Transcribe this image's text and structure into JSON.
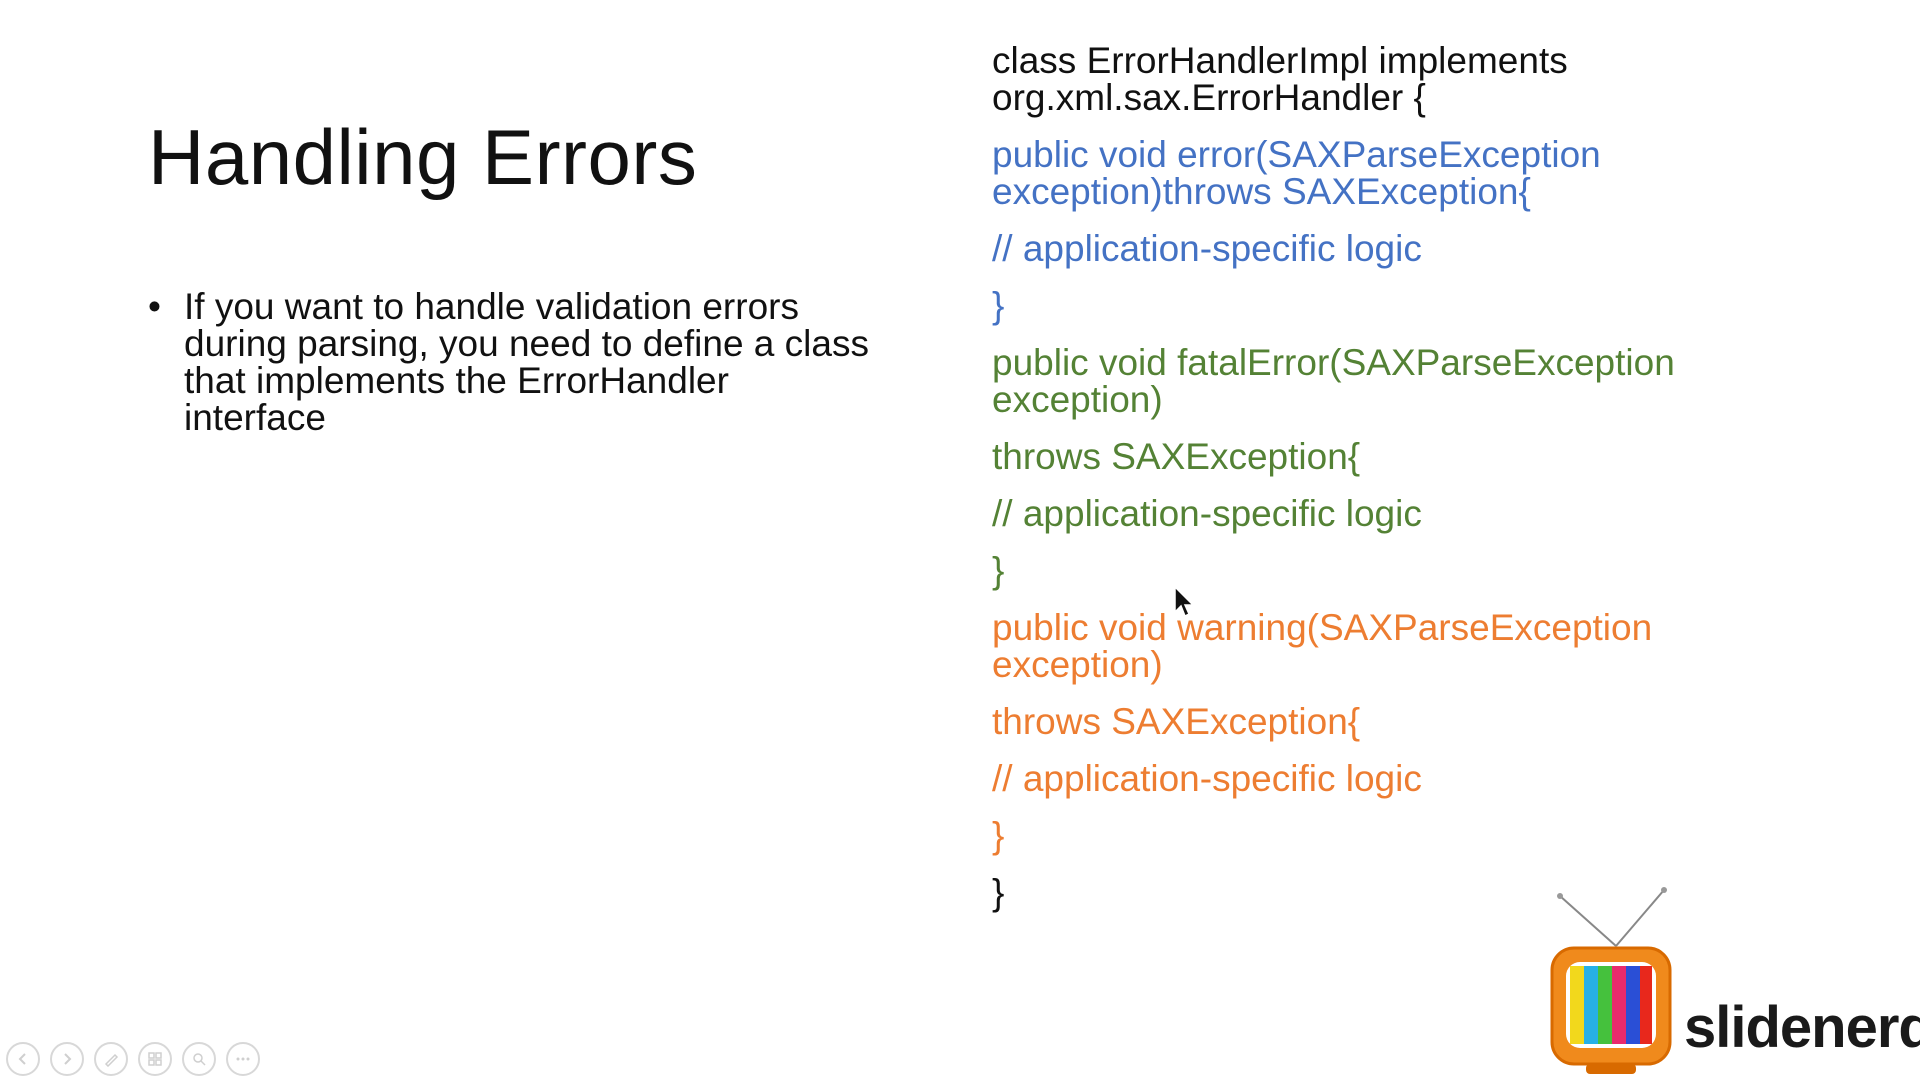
{
  "slide": {
    "title": "Handling Errors",
    "bullets": [
      {
        "lines": [
          "If you want to handle validation errors",
          "during parsing, you need to define a class",
          "that implements the ErrorHandler",
          "interface"
        ]
      }
    ]
  },
  "code": {
    "class_decl": [
      "class ErrorHandlerImpl implements",
      "org.xml.sax.ErrorHandler {"
    ],
    "error_method": {
      "color": "#4472c4",
      "signature": [
        "public void error(SAXParseException",
        "exception)throws SAXException{"
      ],
      "comment": "// application-specific logic",
      "close": "}"
    },
    "fatal_method": {
      "color": "#548235",
      "signature": [
        "public void fatalError(SAXParseException",
        "exception)"
      ],
      "throws": "throws SAXException{",
      "comment": "// application-specific logic",
      "close": "}"
    },
    "warning_method": {
      "color": "#ed7d31",
      "signature": [
        "public void warning(SAXParseException",
        "exception)"
      ],
      "throws": "throws SAXException{",
      "comment": "// application-specific logic",
      "close": "}"
    },
    "class_close": "}"
  },
  "branding": {
    "logo_text": "slidenerd",
    "tv_icon": "retro-tv-icon"
  },
  "toolbar": {
    "buttons": [
      "previous-slide-icon",
      "next-slide-icon",
      "pen-icon",
      "slides-grid-icon",
      "zoom-icon",
      "more-options-icon"
    ]
  }
}
